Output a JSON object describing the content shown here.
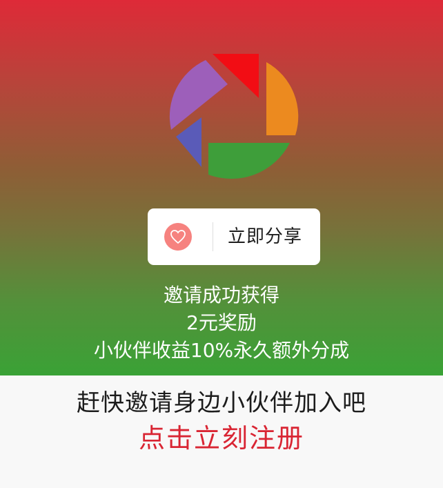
{
  "share": {
    "icon": "heart-icon",
    "label": "立即分享"
  },
  "reward": {
    "line1": "邀请成功获得",
    "line2": "2元奖励",
    "line3": "小伙伴收益10%永久额外分成"
  },
  "footer": {
    "invite_text": "赶快邀请身边小伙伴加入吧",
    "register_link": "点击立刻注册"
  },
  "colors": {
    "gradient_top": "#de2a38",
    "gradient_bottom": "#3aa236",
    "heart_bg": "#f6827f",
    "register_link": "#d92533"
  }
}
